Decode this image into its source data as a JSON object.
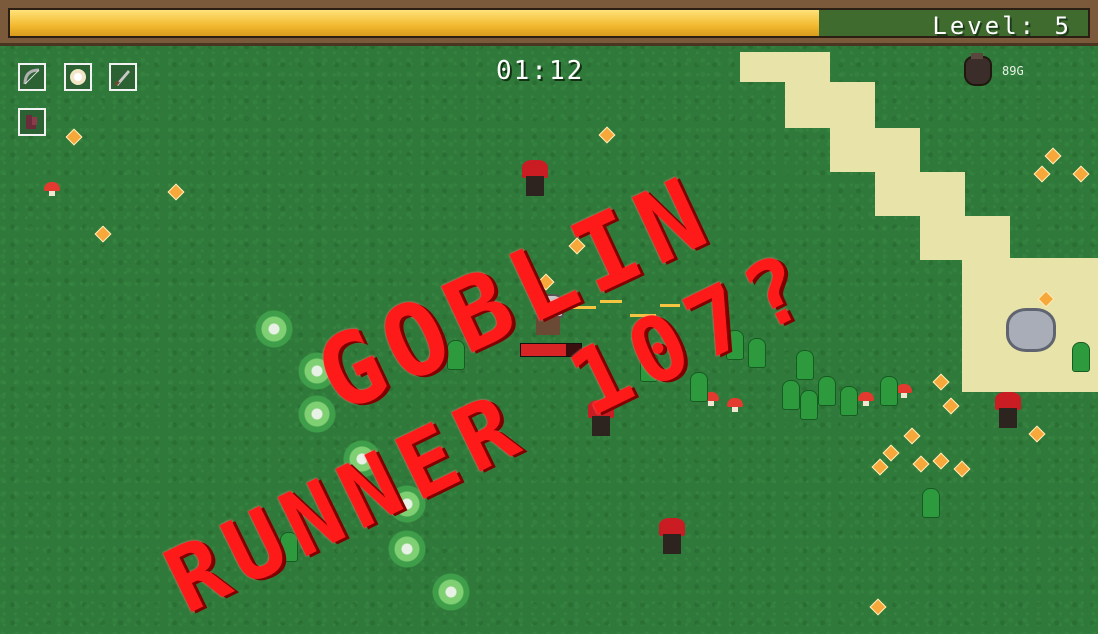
{
  "hud": {
    "level_label": "Level: 5",
    "xp_progress": 0.75,
    "timer": "01:12",
    "gold": "89G"
  },
  "weapon_slots": [
    {
      "icon": "bow-icon"
    },
    {
      "icon": "burst-icon"
    },
    {
      "icon": "dagger-icon"
    },
    {
      "icon": "boots-icon"
    }
  ],
  "player": {
    "hp_fraction": 0.75
  },
  "overlay": {
    "line1": "GOBLIN",
    "line2": "RUNNER 107?"
  },
  "colors": {
    "grass": "#2f7a3a",
    "xp_fill": "#f2b92f",
    "overlay_text": "#ff1a1a",
    "sand": "#e8e3a8"
  }
}
